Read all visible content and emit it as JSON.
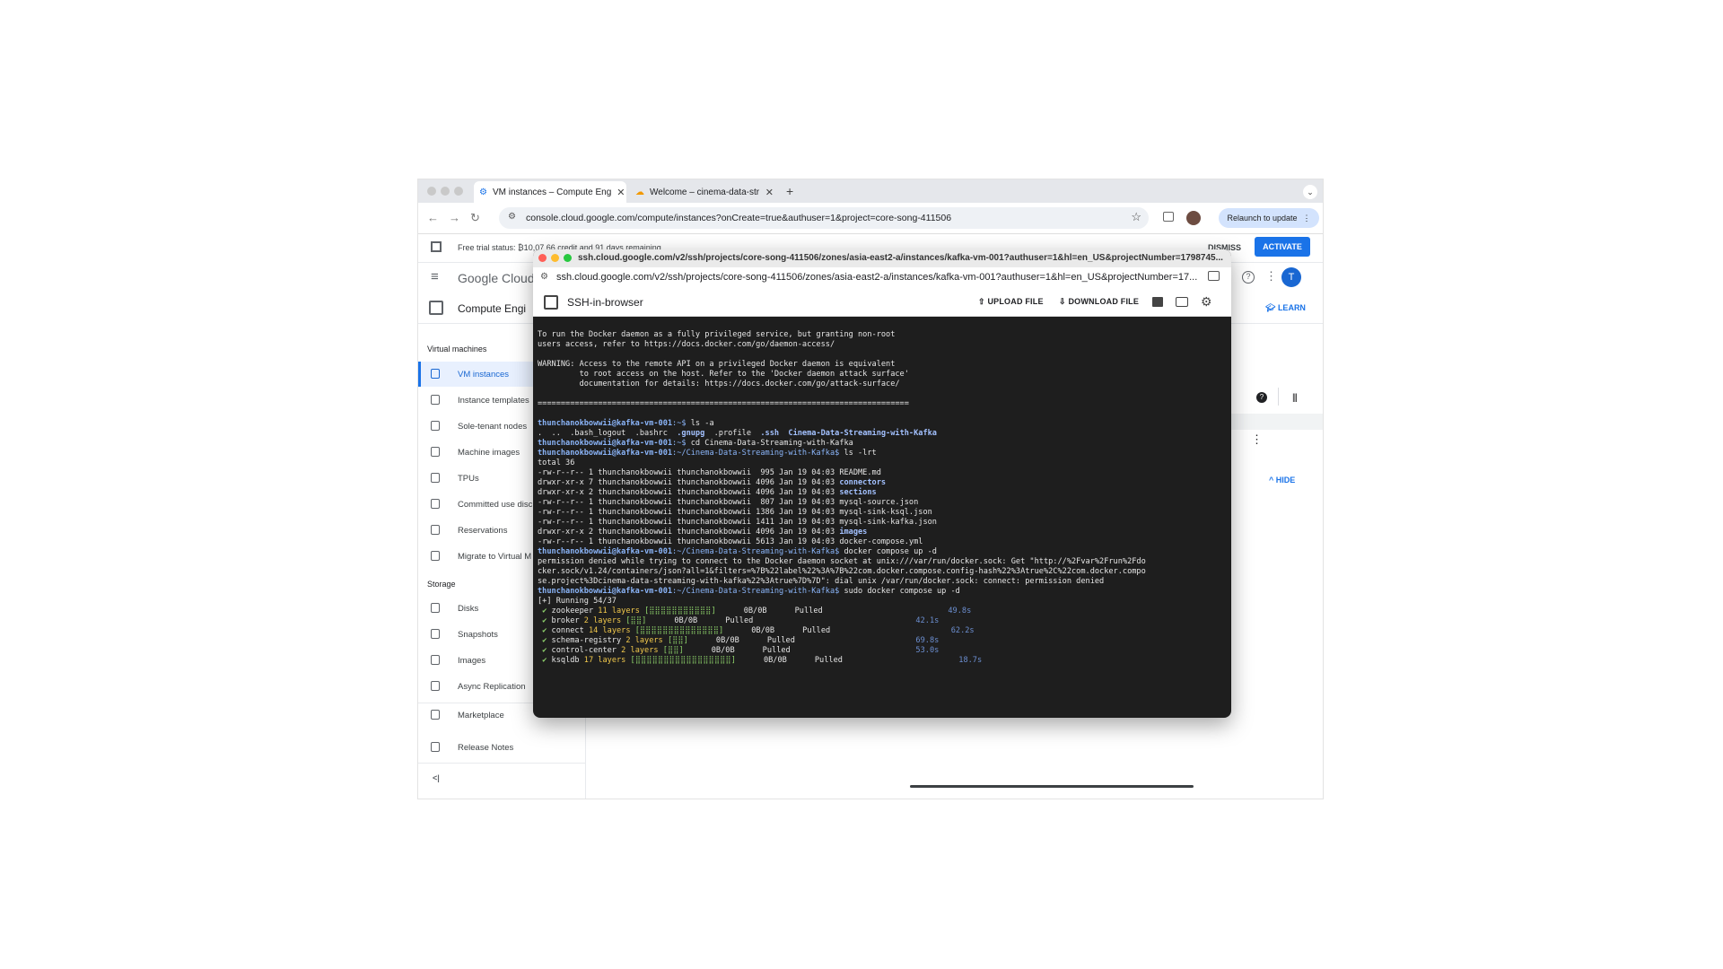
{
  "browser": {
    "tabs": [
      {
        "label": "VM instances – Compute Eng",
        "active": true
      },
      {
        "label": "Welcome – cinema-data-str",
        "active": false
      }
    ],
    "new_tab": "+",
    "url": "console.cloud.google.com/compute/instances?onCreate=true&authuser=1&project=core-song-411506",
    "relaunch": "Relaunch to update"
  },
  "gcp": {
    "banner": "Free trial status: ₿10,07.66 credit and 91 days remaining...",
    "dismiss": "DISMISS",
    "activate": "ACTIVATE",
    "logo": "Google Cloud",
    "product": "Compute Engi",
    "learn": "LEARN",
    "hide": "HIDE",
    "avatar_letter": "T",
    "sections": {
      "vm": "Virtual machines",
      "storage": "Storage"
    },
    "sidebar": [
      {
        "label": "VM instances",
        "icon": "vm-icon"
      },
      {
        "label": "Instance templates",
        "icon": "template-icon"
      },
      {
        "label": "Sole-tenant nodes",
        "icon": "node-icon"
      },
      {
        "label": "Machine images",
        "icon": "image-icon"
      },
      {
        "label": "TPUs",
        "icon": "tpu-icon"
      },
      {
        "label": "Committed use disc",
        "icon": "discount-icon"
      },
      {
        "label": "Reservations",
        "icon": "reservation-icon"
      },
      {
        "label": "Migrate to Virtual M",
        "icon": "migrate-icon"
      },
      {
        "label": "Disks",
        "icon": "disk-icon"
      },
      {
        "label": "Snapshots",
        "icon": "snapshot-icon"
      },
      {
        "label": "Images",
        "icon": "images-icon"
      },
      {
        "label": "Async Replication",
        "icon": "replication-icon"
      },
      {
        "label": "Marketplace",
        "icon": "cart-icon"
      },
      {
        "label": "Release Notes",
        "icon": "notes-icon"
      }
    ],
    "collapse": "<|"
  },
  "ssh": {
    "title_url": "ssh.cloud.google.com/v2/ssh/projects/core-song-411506/zones/asia-east2-a/instances/kafka-vm-001?authuser=1&hl=en_US&projectNumber=1798745...",
    "addr_url": "ssh.cloud.google.com/v2/ssh/projects/core-song-411506/zones/asia-east2-a/instances/kafka-vm-001?authuser=1&hl=en_US&projectNumber=17...",
    "app_title": "SSH-in-browser",
    "upload": "UPLOAD FILE",
    "download": "DOWNLOAD FILE",
    "terminal": {
      "intro": [
        "To run the Docker daemon as a fully privileged service, but granting non-root",
        "users access, refer to https://docs.docker.com/go/daemon-access/",
        "",
        "WARNING: Access to the remote API on a privileged Docker daemon is equivalent",
        "         to root access on the host. Refer to the 'Docker daemon attack surface'",
        "         documentation for details: https://docs.docker.com/go/attack-surface/",
        "",
        "================================================================================",
        ""
      ],
      "prompt_user": "thunchanokbowwii@kafka-vm-001",
      "home_path": ":~$",
      "repo_path": ":~/Cinema-Data-Streaming-with-Kafka$",
      "cmd1": " ls -a",
      "ls_a_plain": ".  ..  .bash_logout  .bashrc  ",
      "ls_a_gnupg": ".gnupg",
      "ls_a_profile": "  .profile  ",
      "ls_a_ssh": ".ssh",
      "ls_a_repo": "  Cinema-Data-Streaming-with-Kafka",
      "cmd2": " cd Cinema-Data-Streaming-with-Kafka",
      "cmd3": " ls -lrt",
      "total": "total 36",
      "listing": [
        {
          "prefix": "-rw-r--r-- 1 thunchanokbowwii thunchanokbowwii  995 Jan 19 04:03 ",
          "name": "README.md",
          "dir": false
        },
        {
          "prefix": "drwxr-xr-x 7 thunchanokbowwii thunchanokbowwii 4096 Jan 19 04:03 ",
          "name": "connectors",
          "dir": true
        },
        {
          "prefix": "drwxr-xr-x 2 thunchanokbowwii thunchanokbowwii 4096 Jan 19 04:03 ",
          "name": "sections",
          "dir": true
        },
        {
          "prefix": "-rw-r--r-- 1 thunchanokbowwii thunchanokbowwii  807 Jan 19 04:03 ",
          "name": "mysql-source.json",
          "dir": false
        },
        {
          "prefix": "-rw-r--r-- 1 thunchanokbowwii thunchanokbowwii 1386 Jan 19 04:03 ",
          "name": "mysql-sink-ksql.json",
          "dir": false
        },
        {
          "prefix": "-rw-r--r-- 1 thunchanokbowwii thunchanokbowwii 1411 Jan 19 04:03 ",
          "name": "mysql-sink-kafka.json",
          "dir": false
        },
        {
          "prefix": "drwxr-xr-x 2 thunchanokbowwii thunchanokbowwii 4096 Jan 19 04:03 ",
          "name": "images",
          "dir": true
        },
        {
          "prefix": "-rw-r--r-- 1 thunchanokbowwii thunchanokbowwii 5613 Jan 19 04:03 ",
          "name": "docker-compose.yml",
          "dir": false
        }
      ],
      "cmd4": " docker compose up -d",
      "error": [
        "permission denied while trying to connect to the Docker daemon socket at unix:///var/run/docker.sock: Get \"http://%2Fvar%2Frun%2Fdo",
        "cker.sock/v1.24/containers/json?all=1&filters=%7B%22label%22%3A%7B%22com.docker.compose.config-hash%22%3Atrue%2C%22com.docker.compo",
        "se.project%3Dcinema-data-streaming-with-kafka%22%3Atrue%7D%7D\": dial unix /var/run/docker.sock: connect: permission denied"
      ],
      "cmd5": " sudo docker compose up -d",
      "running": "[+] Running 54/37",
      "services": [
        {
          "name": " zookeeper ",
          "layers": "11 layers",
          "bar": "[⣿⣿⣿⣿⣿⣿⣿⣿⣿⣿⣿]",
          "size": "0B/0B",
          "status": "Pulled",
          "time": "49.8s"
        },
        {
          "name": " broker ",
          "layers": "2 layers",
          "bar": "[⣿⣿]",
          "size": "0B/0B",
          "status": "Pulled",
          "time": "42.1s"
        },
        {
          "name": " connect ",
          "layers": "14 layers",
          "bar": "[⣿⣿⣿⣿⣿⣿⣿⣿⣿⣿⣿⣿⣿⣿]",
          "size": "0B/0B",
          "status": "Pulled",
          "time": "62.2s"
        },
        {
          "name": " schema-registry ",
          "layers": "2 layers",
          "bar": "[⣿⣿]",
          "size": "0B/0B",
          "status": "Pulled",
          "time": "69.8s"
        },
        {
          "name": " control-center ",
          "layers": "2 layers",
          "bar": "[⣿⣿]",
          "size": "0B/0B",
          "status": "Pulled",
          "time": "53.0s"
        },
        {
          "name": " ksqldb ",
          "layers": "17 layers",
          "bar": "[⣿⣿⣿⣿⣿⣿⣿⣿⣿⣿⣿⣿⣿⣿⣿⣿⣿]",
          "size": "0B/0B",
          "status": "Pulled",
          "time": "18.7s"
        }
      ],
      "check": "✔"
    }
  }
}
